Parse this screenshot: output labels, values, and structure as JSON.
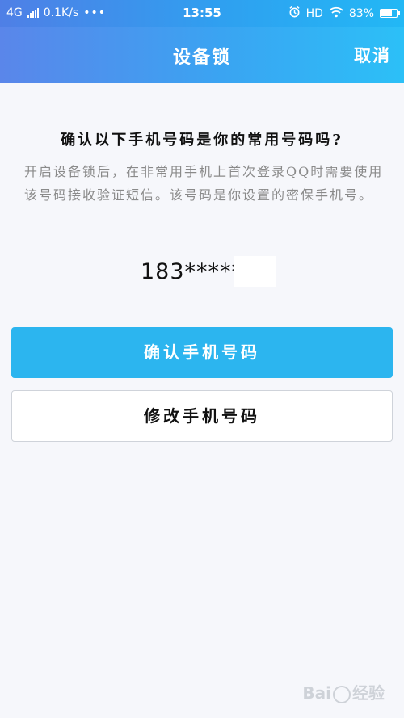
{
  "status_bar": {
    "network": "4G",
    "speed": "0.1K/s",
    "dots": "•••",
    "time": "13:55",
    "hd": "HD",
    "battery_percent": "83%",
    "battery_level": 0.83,
    "icons": [
      "signal-icon",
      "alarm-icon",
      "wifi-icon",
      "battery-icon"
    ]
  },
  "nav": {
    "title": "设备锁",
    "cancel_label": "取消"
  },
  "main": {
    "question": "确认以下手机号码是你的常用号码吗?",
    "description": "开启设备锁后，在非常用手机上首次登录QQ时需要使用该号码接收验证短信。该号码是你设置的密保手机号。",
    "phone_number": "183******"
  },
  "buttons": {
    "confirm_label": "确认手机号码",
    "modify_label": "修改手机号码"
  },
  "watermark": {
    "brand": "Bai",
    "suffix": "经验"
  },
  "colors": {
    "nav_start": "#5a86ea",
    "nav_end": "#2cc0f7",
    "primary_button": "#2cb5ef",
    "background": "#f6f7fb"
  }
}
